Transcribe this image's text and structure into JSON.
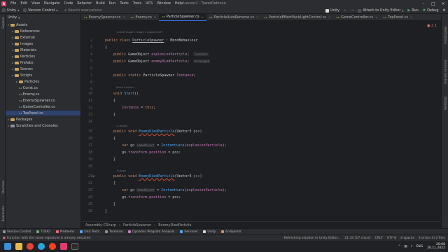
{
  "window": {
    "title": "Lesson2 - TowerDefence",
    "menu": [
      "File",
      "Edit",
      "View",
      "Navigate",
      "Code",
      "Refactor",
      "Build",
      "Run",
      "Tests",
      "Tools",
      "VCS",
      "Window",
      "Help"
    ]
  },
  "navbar": {
    "project": "Unity",
    "vcs": "Version Control",
    "search_placeholder": "Search everywhere",
    "unity_label": "Unity",
    "attach_label": "Attach to Unity Editor",
    "run_label": "Run",
    "debug_label": "Debug"
  },
  "side_panels": {
    "left": [
      "Explorer",
      "Structure",
      "Bookmarks"
    ],
    "right": [
      "Notifications",
      "Errors In Solution",
      "Database"
    ]
  },
  "explorer": {
    "header": "Unity",
    "items": [
      {
        "label": "Assets",
        "depth": 0,
        "kind": "folder",
        "expanded": true
      },
      {
        "label": "References",
        "depth": 1,
        "kind": "folder"
      },
      {
        "label": "External",
        "depth": 1,
        "kind": "folder"
      },
      {
        "label": "Images",
        "depth": 1,
        "kind": "folder"
      },
      {
        "label": "Materials",
        "depth": 1,
        "kind": "folder"
      },
      {
        "label": "Particles",
        "depth": 1,
        "kind": "folder"
      },
      {
        "label": "Prefabs",
        "depth": 1,
        "kind": "folder"
      },
      {
        "label": "Scenes",
        "depth": 1,
        "kind": "folder"
      },
      {
        "label": "Scripts",
        "depth": 1,
        "kind": "folder",
        "expanded": true
      },
      {
        "label": "Particles",
        "depth": 2,
        "kind": "folder"
      },
      {
        "label": "Const.cs",
        "depth": 2,
        "kind": "cs"
      },
      {
        "label": "Enemy.cs",
        "depth": 2,
        "kind": "cs"
      },
      {
        "label": "EnemySpawner.cs",
        "depth": 2,
        "kind": "cs"
      },
      {
        "label": "GameController.cs",
        "depth": 2,
        "kind": "cs"
      },
      {
        "label": "TopPanel.cs",
        "depth": 2,
        "kind": "cs",
        "selected": true
      },
      {
        "label": "Packages",
        "depth": 0,
        "kind": "folder"
      },
      {
        "label": "Scratches and Consoles",
        "depth": 0,
        "kind": "scratch"
      }
    ]
  },
  "tabs": [
    {
      "label": "EnemySpawner.cs",
      "active": false
    },
    {
      "label": "Enemy.cs",
      "active": false
    },
    {
      "label": "ParticleSpawner.cs",
      "active": true
    },
    {
      "label": "ParticleAutoRemove.cs",
      "active": false
    },
    {
      "label": "ParticleEffectPackLightControl.cs",
      "active": false
    },
    {
      "label": "GameController.cs",
      "active": false
    },
    {
      "label": "TopPanel.cs",
      "active": false
    }
  ],
  "editor": {
    "problems_badge": "2 1",
    "hints": {
      "class": "1 asset usage   1 usage   1 exposing API",
      "start": "Event function",
      "usages": "2 usages",
      "usage": "1 usage"
    },
    "field_hints": {
      "set_in_unity": "Tootbalt",
      "unchanged": "Unchanged"
    },
    "inlay_gameobject": "GameObject"
  },
  "breadcrumb": [
    "Assembly-CSharp",
    "ParticleSpawner",
    "EnemyDiedParticle"
  ],
  "bottom_tools": [
    "Version Control",
    "TODO",
    "Problems",
    "Unit Tests",
    "Terminal",
    "Dynamic Program Analysis",
    "Services",
    "Unity",
    "Endpoints"
  ],
  "status": {
    "message": "Function with the same signature is already declared",
    "refresh": "Refreshing solution in Unity Editor...",
    "position": "21:34 (17 chars)",
    "line_sep": "CRLF",
    "encoding": "UTF-8",
    "indent": "4 spaces",
    "errors": "4 errors in 2 files"
  },
  "taskbar": {
    "lang": "ENG",
    "time": "20:08",
    "date": "26.11.2022"
  },
  "colors": {
    "accent": "#3574f0",
    "error": "#e06c6c",
    "keyword": "#cf8e6d",
    "method": "#56a8f5"
  }
}
